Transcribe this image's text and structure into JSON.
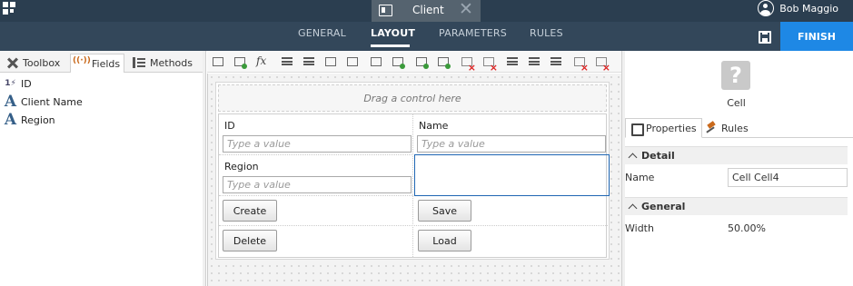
{
  "topbar": {
    "doc_tab_label": "Client",
    "user_name": "Bob Maggio"
  },
  "nav": {
    "tabs": [
      "GENERAL",
      "LAYOUT",
      "PARAMETERS",
      "RULES"
    ],
    "active_tab": "LAYOUT",
    "finish_label": "FINISH"
  },
  "left_panel": {
    "tabs": [
      "Toolbox",
      "Fields",
      "Methods"
    ],
    "active_tab": "Fields",
    "fields": [
      {
        "label": "ID",
        "icon": "autonumber-icon"
      },
      {
        "label": "Client Name",
        "icon": "text-field-icon"
      },
      {
        "label": "Region",
        "icon": "text-field-icon"
      }
    ]
  },
  "canvas": {
    "drop_hint": "Drag a control here",
    "id_label": "ID",
    "name_label": "Name",
    "region_label": "Region",
    "input_placeholder": "Type a value",
    "buttons": {
      "create": "Create",
      "save": "Save",
      "delete": "Delete",
      "load": "Load"
    }
  },
  "right_panel": {
    "object_title": "Cell",
    "tabs": [
      "Properties",
      "Rules"
    ],
    "active_tab": "Properties",
    "detail_header": "Detail",
    "name_label": "Name",
    "name_value": "Cell Cell4",
    "general_header": "General",
    "width_label": "Width",
    "width_value": "50.00%"
  },
  "colors": {
    "topbar": "#2b3e50",
    "navbar": "#33475a",
    "finish": "#1e88e5",
    "selected_cell_border": "#1f66b3"
  }
}
